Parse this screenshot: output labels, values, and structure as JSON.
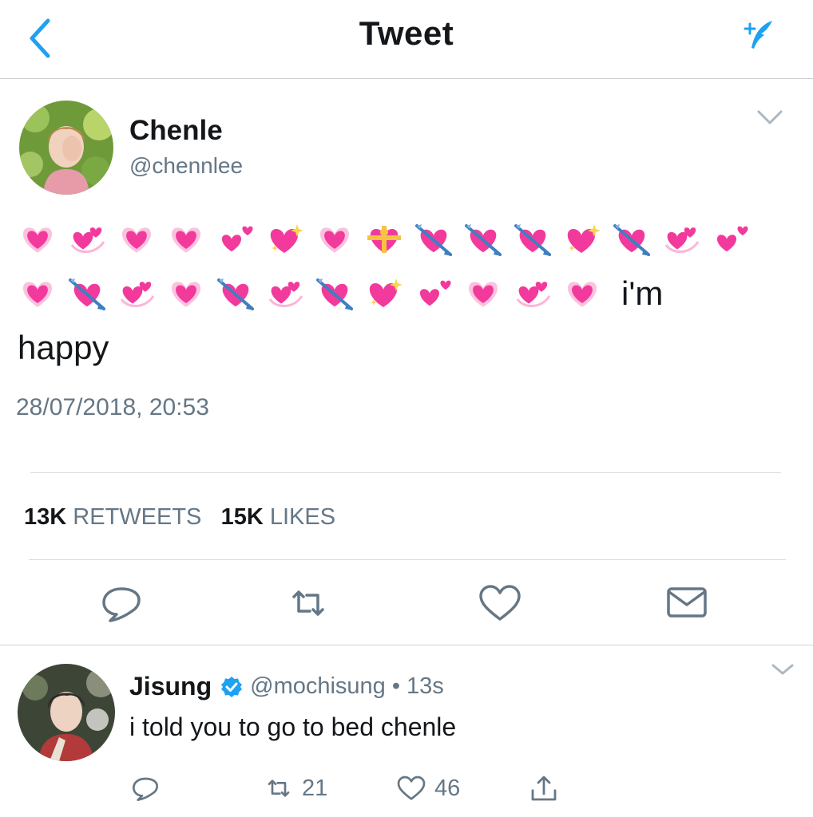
{
  "header": {
    "title": "Tweet",
    "back_icon": "chevron-left-icon",
    "compose_icon": "compose-tweet-icon",
    "accent": "#1da1f2"
  },
  "tweet": {
    "name": "Chenle",
    "handle": "@chennlee",
    "text_end": "i'm",
    "text_line2": "happy",
    "heart_color": "#f23a9c",
    "emoji_line1": [
      "heart-pink",
      "heart-revolving",
      "heart-pink",
      "heart-pink",
      "heart-small-two",
      "heart-sparkle",
      "heart-pink",
      "heart-ribbon",
      "heart-arrow",
      "heart-arrow",
      "heart-arrow",
      "heart-sparkle",
      "heart-arrow",
      "heart-revolving",
      "heart-small-two"
    ],
    "emoji_line2": [
      "heart-pink",
      "heart-arrow",
      "heart-revolving",
      "heart-pink",
      "heart-arrow",
      "heart-revolving",
      "heart-arrow",
      "heart-sparkle",
      "heart-small-two",
      "heart-pink",
      "heart-revolving",
      "heart-pink"
    ],
    "timestamp": "28/07/2018, 20:53",
    "retweets_count": "13K",
    "retweets_label": "RETWEETS",
    "likes_count": "15K",
    "likes_label": "LIKES",
    "actions": [
      "reply-icon",
      "retweet-icon",
      "like-icon",
      "message-icon"
    ]
  },
  "reply": {
    "name": "Jisung",
    "handle": "@mochisung",
    "separator": "•",
    "time": "13s",
    "text": "i told you to go to bed chenle",
    "retweets": "21",
    "likes": "46",
    "verified_color": "#1da1f2"
  }
}
